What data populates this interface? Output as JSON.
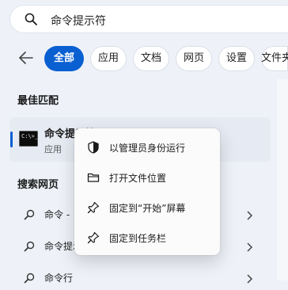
{
  "search": {
    "query": "命令提示符"
  },
  "filters": {
    "tabs": [
      "全部",
      "应用",
      "文档",
      "网页",
      "设置",
      "文件夹"
    ],
    "active_index": 0
  },
  "best_match": {
    "heading": "最佳匹配",
    "name": "命令提示符",
    "type": "应用"
  },
  "web_search": {
    "heading": "搜索网页",
    "items": [
      "命令 - ",
      "命令提示符",
      "命令行"
    ]
  },
  "context_menu": {
    "items": [
      {
        "label": "以管理员身份运行",
        "icon": "shield-icon"
      },
      {
        "label": "打开文件位置",
        "icon": "folder-icon"
      },
      {
        "label": "固定到“开始”屏幕",
        "icon": "pin-icon"
      },
      {
        "label": "固定到任务栏",
        "icon": "pin-icon"
      }
    ]
  },
  "colors": {
    "accent": "#0a5fd1",
    "background": "#eef2f8"
  }
}
